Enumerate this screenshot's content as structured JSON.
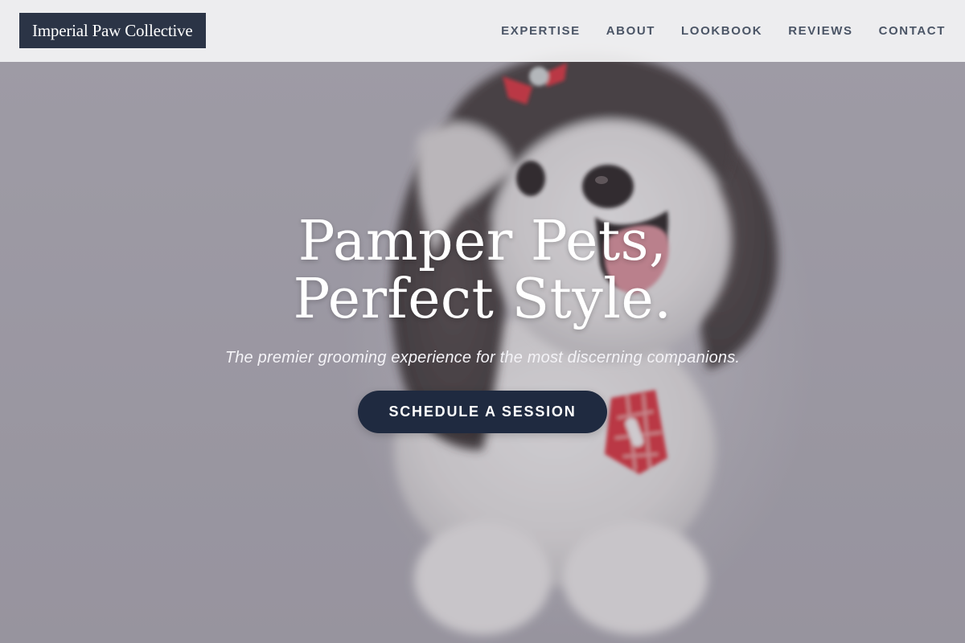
{
  "brand": {
    "name": "Imperial Paw Collective"
  },
  "nav": {
    "items": [
      {
        "label": "EXPERTISE"
      },
      {
        "label": "ABOUT"
      },
      {
        "label": "LOOKBOOK"
      },
      {
        "label": "REVIEWS"
      },
      {
        "label": "CONTACT"
      }
    ]
  },
  "hero": {
    "title": "Pamper Pets, Perfect Style.",
    "subtitle": "The premier grooming experience for the most discerning companions.",
    "cta_label": "SCHEDULE A SESSION",
    "image_subject": "shih-tzu-dog-photo"
  },
  "colors": {
    "brand_bg": "#2b3446",
    "cta_bg": "#1f2a40",
    "nav_text": "#4b5566",
    "navbar_bg": "#f3f3f4",
    "bow_red": "#d92630"
  }
}
